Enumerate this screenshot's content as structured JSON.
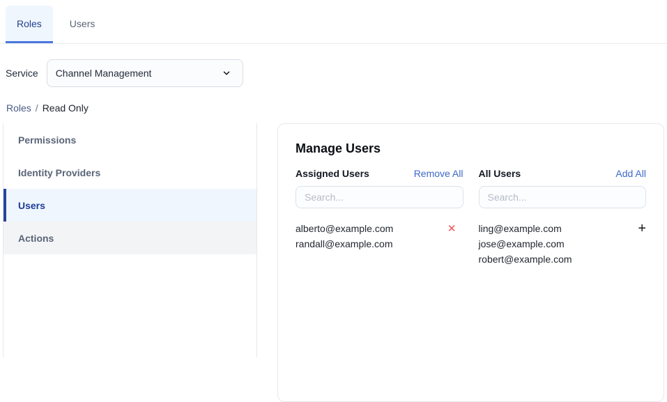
{
  "colors": {
    "accent_blue": "#3e68c9",
    "active_tab_text": "#21418f",
    "tab_underline": "#4a77dd",
    "active_bg": "#f0f6fd",
    "sidebar_active_text": "#1c3e97",
    "sidebar_active_border": "#27459c",
    "danger_red": "#f05252"
  },
  "tabs": [
    {
      "label": "Roles",
      "state": "active"
    },
    {
      "label": "Users",
      "state": "default"
    }
  ],
  "service": {
    "label": "Service",
    "selected": "Channel Management"
  },
  "breadcrumb": {
    "parent": "Roles",
    "separator": "/",
    "current": "Read Only"
  },
  "sidebar": {
    "items": [
      {
        "label": "Permissions",
        "state": "default"
      },
      {
        "label": "Identity Providers",
        "state": "default"
      },
      {
        "label": "Users",
        "state": "active"
      },
      {
        "label": "Actions",
        "state": "muted"
      }
    ]
  },
  "manage_users": {
    "title": "Manage Users",
    "assigned": {
      "heading": "Assigned Users",
      "action_label": "Remove All",
      "search_placeholder": "Search...",
      "row_action_icon": "✕",
      "users": [
        {
          "email": "alberto@example.com",
          "show_action": true
        },
        {
          "email": "randall@example.com",
          "show_action": false
        }
      ]
    },
    "all": {
      "heading": "All Users",
      "action_label": "Add All",
      "search_placeholder": "Search...",
      "row_action_icon": "+",
      "users": [
        {
          "email": "ling@example.com",
          "show_action": true
        },
        {
          "email": "jose@example.com",
          "show_action": false
        },
        {
          "email": "robert@example.com",
          "show_action": false
        }
      ]
    }
  }
}
